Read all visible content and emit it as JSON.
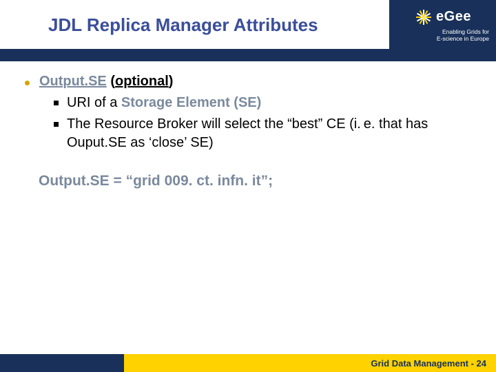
{
  "header": {
    "title": "JDL Replica Manager Attributes",
    "logo": {
      "name": "eGee",
      "tagline_l1": "Enabling Grids for",
      "tagline_l2": "E-science in Europe"
    }
  },
  "content": {
    "attr_name": "Output.SE",
    "optional_open": " (",
    "optional_word": "optional",
    "optional_close": ")",
    "sub": [
      {
        "pre": "URI of a ",
        "em": "Storage Element (SE)",
        "post": ""
      },
      {
        "pre": "The Resource Broker will select the “best” CE (i. e. that has Ouput.SE as ‘close’ SE)",
        "em": "",
        "post": ""
      }
    ],
    "example": "Output.SE = “grid 009. ct. infn. it”;"
  },
  "footer": {
    "text": "Grid Data Management - 24"
  }
}
